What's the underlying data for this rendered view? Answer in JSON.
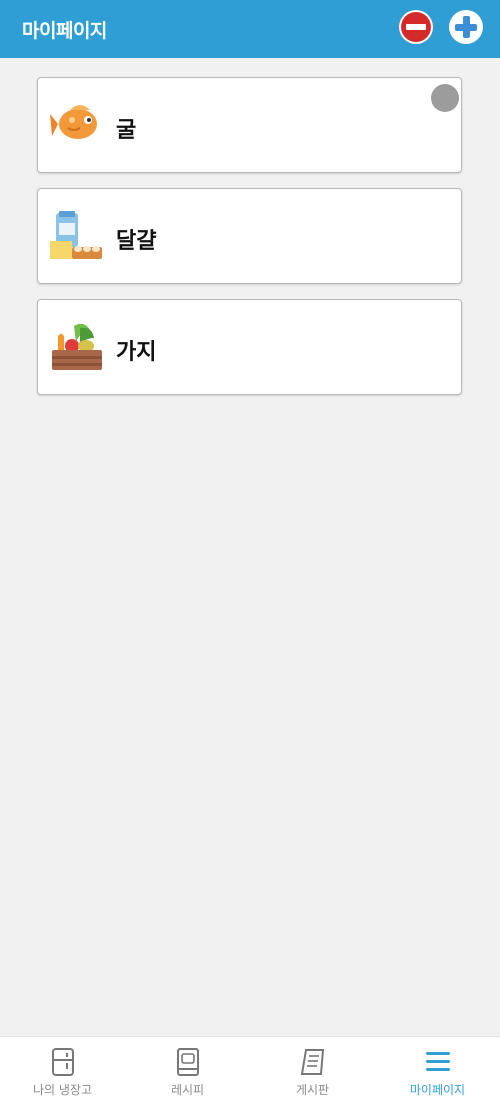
{
  "header": {
    "title": "마이페이지",
    "remove_icon": "minus-circle-icon",
    "add_icon": "plus-circle-icon",
    "accent_color": "#2f9ed4"
  },
  "items": [
    {
      "name": "굴",
      "icon": "fish-icon",
      "selected": true
    },
    {
      "name": "달걀",
      "icon": "dairy-icon",
      "selected": false
    },
    {
      "name": "가지",
      "icon": "vegetable-box-icon",
      "selected": false
    }
  ],
  "bottom_nav": [
    {
      "label": "나의 냉장고",
      "icon": "fridge-icon",
      "active": false
    },
    {
      "label": "레시피",
      "icon": "recipe-book-icon",
      "active": false
    },
    {
      "label": "게시판",
      "icon": "board-icon",
      "active": false
    },
    {
      "label": "마이페이지",
      "icon": "menu-icon",
      "active": true
    }
  ]
}
